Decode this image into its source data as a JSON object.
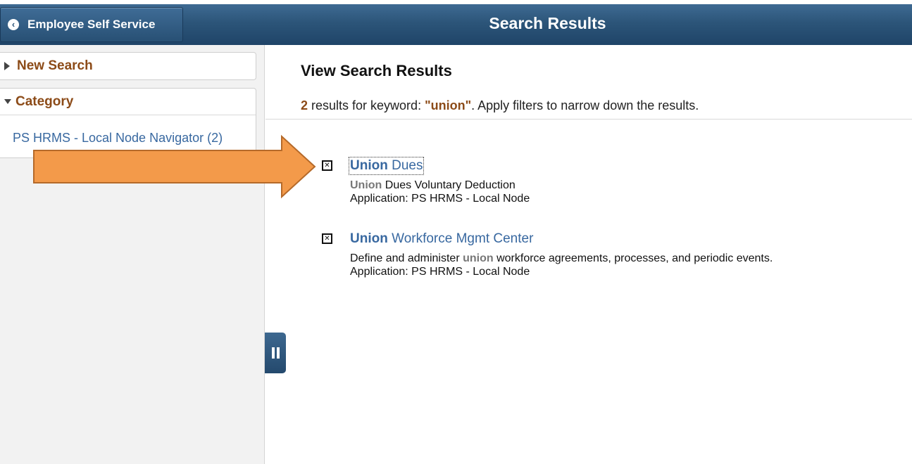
{
  "header": {
    "back_label": "Employee Self Service",
    "title": "Search Results"
  },
  "sidebar": {
    "new_search_label": "New Search",
    "category_label": "Category",
    "items": [
      {
        "label": "PS HRMS - Local Node Navigator (2)"
      }
    ]
  },
  "main": {
    "heading": "View Search Results",
    "summary": {
      "count": "2",
      "text_a": " results for keyword: ",
      "keyword": "\"union\"",
      "text_b": ". Apply filters to narrow down the results."
    },
    "results": [
      {
        "title_bold": "Union",
        "title_rest": " Dues",
        "desc_highlight": "Union",
        "desc_rest": " Dues Voluntary Deduction",
        "application": "Application: PS HRMS - Local Node"
      },
      {
        "title_bold": "Union",
        "title_rest": " Workforce Mgmt Center",
        "desc_before": "Define and administer ",
        "desc_highlight": "union",
        "desc_after": " workforce agreements, processes, and periodic events.",
        "application": "Application: PS HRMS - Local Node"
      }
    ]
  },
  "colors": {
    "header": "#2c5579",
    "accent_brown": "#8c4b18",
    "link_blue": "#3868a0",
    "arrow_orange": "#f39a4a"
  },
  "icons": {
    "back": "chevron-left-icon",
    "collapse": "pause-icon",
    "result": "boxed-x-icon"
  }
}
